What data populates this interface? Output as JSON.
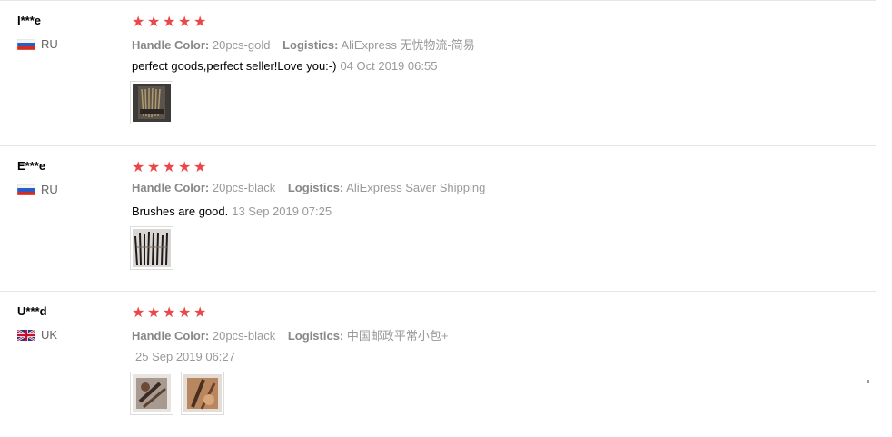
{
  "labels": {
    "handle_color": "Handle Color:",
    "logistics": "Logistics:"
  },
  "reviews": [
    {
      "user": "I***e",
      "country": "RU",
      "flag": "russia-flag",
      "stars": 5,
      "handle_color": "20pcs-gold",
      "logistics": "AliExpress 无忧物流-简易",
      "text": "perfect goods,perfect seller!Love you:-)",
      "date": "04 Oct 2019 06:55",
      "photos": [
        "brush-photo-gold-set"
      ]
    },
    {
      "user": "E***e",
      "country": "RU",
      "flag": "russia-flag",
      "stars": 5,
      "handle_color": "20pcs-black",
      "logistics": "AliExpress Saver Shipping",
      "text": "Brushes are good.",
      "date": "13 Sep 2019 07:25",
      "photos": [
        "brush-photo-black-set"
      ]
    },
    {
      "user": "U***d",
      "country": "UK",
      "flag": "uk-flag",
      "stars": 5,
      "handle_color": "20pcs-black",
      "logistics": "中国邮政平常小包+",
      "text": "",
      "date": "25 Sep 2019 06:27",
      "photos": [
        "brush-photo-closeup-1",
        "brush-photo-closeup-2"
      ]
    }
  ],
  "colors": {
    "star": "#ea4848",
    "muted": "#999999",
    "separator": "#e6e6e6"
  }
}
